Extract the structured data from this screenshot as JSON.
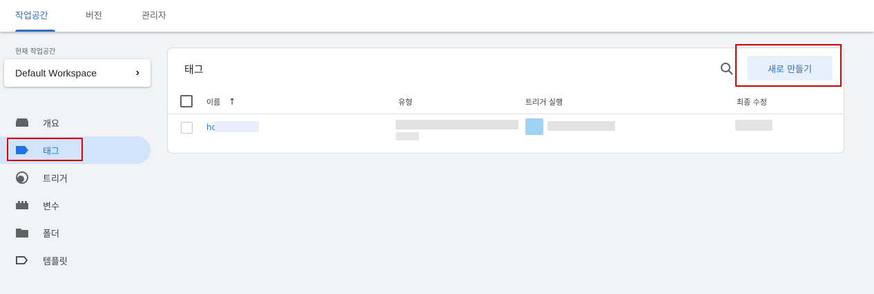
{
  "top_tabs": [
    {
      "label": "작업공간",
      "active": true
    },
    {
      "label": "버전",
      "active": false
    },
    {
      "label": "관리자",
      "active": false
    }
  ],
  "workspace": {
    "caption": "현재 작업공간",
    "name": "Default Workspace",
    "chevron": "›"
  },
  "nav": [
    {
      "label": "개요",
      "icon": "overview-icon",
      "active": false
    },
    {
      "label": "태그",
      "icon": "tag-icon",
      "active": true
    },
    {
      "label": "트리거",
      "icon": "trigger-icon",
      "active": false
    },
    {
      "label": "변수",
      "icon": "variables-icon",
      "active": false
    },
    {
      "label": "폴더",
      "icon": "folder-icon",
      "active": false
    },
    {
      "label": "템플릿",
      "icon": "template-icon",
      "active": false
    }
  ],
  "card": {
    "title": "태그",
    "new_button": "새로 만들기",
    "columns": {
      "name": "이름",
      "sort_arrow": "↑",
      "type": "유형",
      "trigger": "트리거 실행",
      "modified": "최종 수정"
    },
    "rows": [
      {
        "name": "ho"
      }
    ]
  },
  "colors": {
    "accent": "#1a73e8",
    "highlight": "#e00000",
    "active_nav_bg": "#d2e3fc"
  }
}
